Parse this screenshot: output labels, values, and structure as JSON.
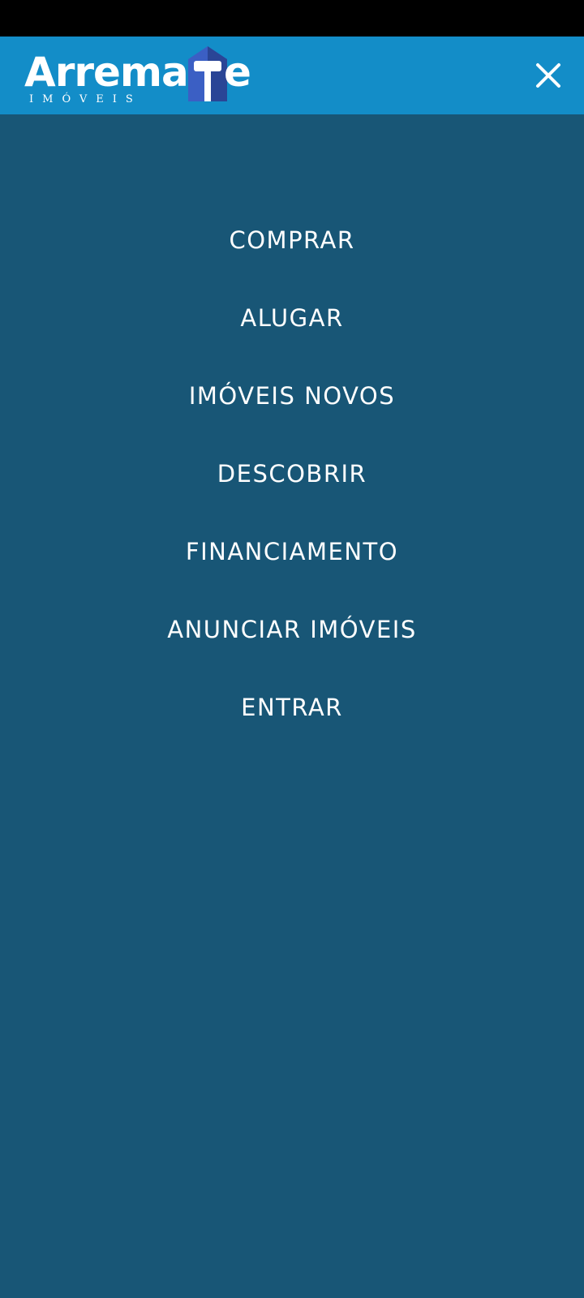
{
  "brand": {
    "name_start": "Arrema",
    "name_end": "e",
    "subtitle": "IMÓVEIS",
    "colors": {
      "header_bg": "#138dc8",
      "menu_bg": "#185676",
      "logo_house": "#3b5fc4",
      "logo_house_dark": "#2a4596"
    }
  },
  "header": {
    "close_icon": "close-icon"
  },
  "menu": {
    "items": [
      {
        "label": "COMPRAR"
      },
      {
        "label": "ALUGAR"
      },
      {
        "label": "IMÓVEIS NOVOS"
      },
      {
        "label": "DESCOBRIR"
      },
      {
        "label": "FINANCIAMENTO"
      },
      {
        "label": "ANUNCIAR IMÓVEIS"
      },
      {
        "label": "ENTRAR"
      }
    ]
  }
}
